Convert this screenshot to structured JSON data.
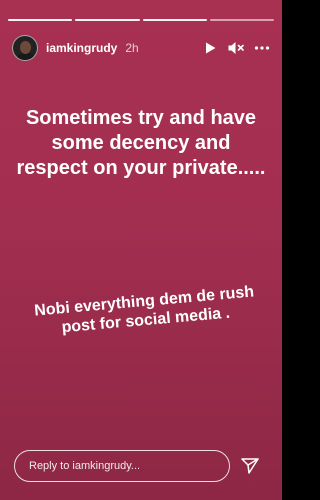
{
  "progress": {
    "segments": 4,
    "completed": 3,
    "current_fraction": 0.0
  },
  "header": {
    "username": "iamkingrudy",
    "time": "2h",
    "icons": [
      "play-icon",
      "mute-icon",
      "more-icon"
    ]
  },
  "story": {
    "background": "#a32f50",
    "main_text": "Sometimes try and have some decency and respect on your private.....",
    "secondary_text": "Nobi everything dem de rush post for social media ."
  },
  "reply": {
    "placeholder": "Reply to iamkingrudy..."
  },
  "send_icon": "paper-plane-icon"
}
